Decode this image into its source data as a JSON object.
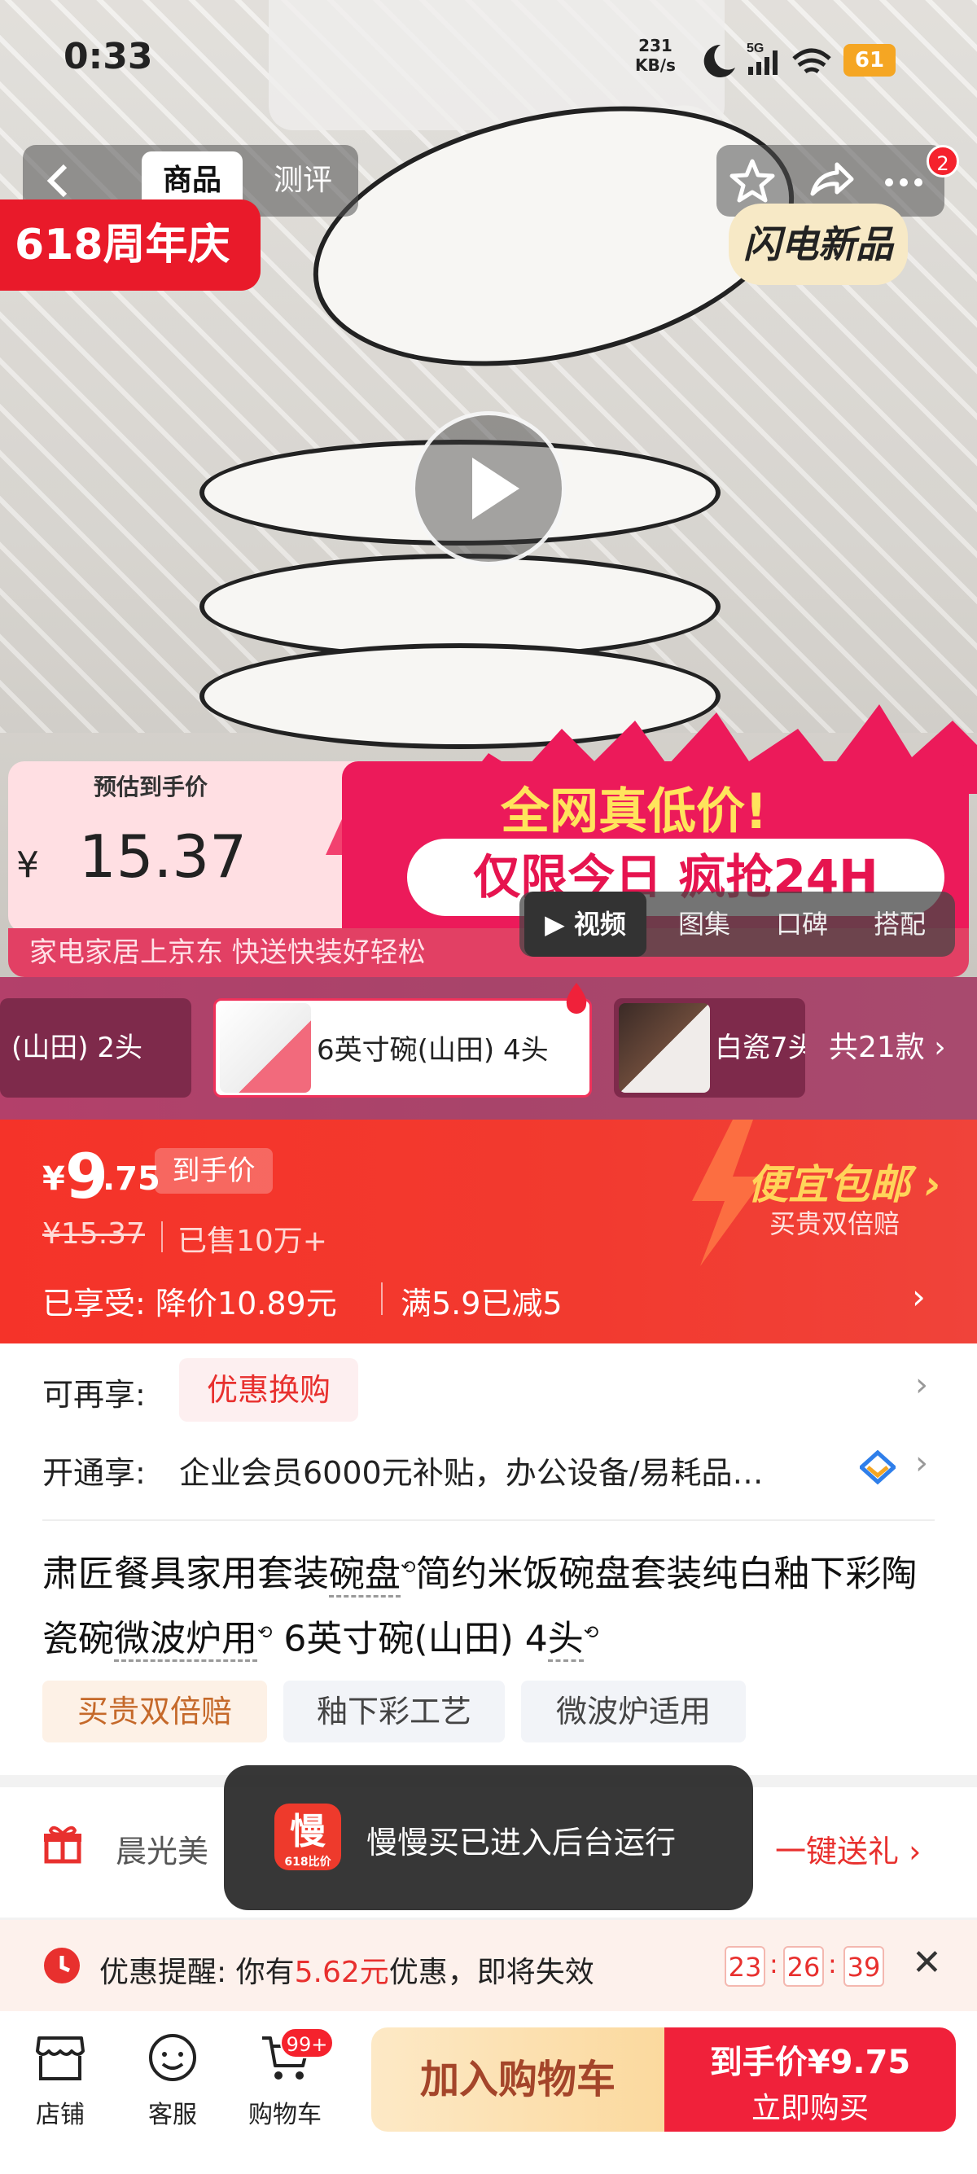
{
  "status_bar": {
    "time": "0:33",
    "net_speed_value": "231",
    "net_speed_unit": "KB/s",
    "network": "5G",
    "battery": "61"
  },
  "header": {
    "tab_product": "商品",
    "tab_review": "测评",
    "cart_badge": "2"
  },
  "hero": {
    "promo_tag": "618周年庆",
    "new_tag": "闪电新品",
    "banner_label": "预估到手价",
    "banner_currency": "¥",
    "banner_price": "15.37",
    "banner_headline": "全网真低价!",
    "banner_sub": "仅限今日 疯抢24H",
    "banner_bottom": "家电家居上京东 快送快装好轻松",
    "media_tabs": [
      "视频",
      "图集",
      "口碑",
      "搭配"
    ]
  },
  "sku": {
    "items": [
      "(山田) 2头",
      "6英寸碗(山田) 4头",
      "白瓷7头"
    ],
    "total": "共21款"
  },
  "price": {
    "currency": "¥",
    "integer": "9",
    "decimal": ".75",
    "tag": "到手价",
    "original": "¥15.37",
    "sold": "已售10万+",
    "enjoyed_label": "已享受:",
    "discount": "降价10.89元",
    "full_reduction": "满5.9已减5",
    "free_ship": "便宜包邮",
    "free_ship_sub": "买贵双倍赔"
  },
  "info": {
    "more_label": "可再享:",
    "coupon_button": "优惠换购",
    "open_label": "开通享:",
    "open_text": "企业会员6000元补贴，办公设备/易耗品…",
    "title_part1": "肃匠餐具家用套装",
    "title_link1": "碗盘",
    "title_part2": "简约米饭碗盘套装纯白釉下彩陶瓷碗",
    "title_link2": "微波炉用",
    "title_part3": " 6英寸碗(山田) 4",
    "title_link3": "头",
    "chips": [
      "买贵双倍赔",
      "釉下彩工艺",
      "微波炉适用"
    ]
  },
  "gift": {
    "text": "晨光美",
    "action": "一键送礼"
  },
  "toast": {
    "icon_char": "慢",
    "icon_sub": "618比价",
    "text": "慢慢买已进入后台运行"
  },
  "reminder": {
    "label": "优惠提醒:",
    "text_before": "你有",
    "amount": "5.62元",
    "text_after": "优惠，即将失效",
    "hours": "23",
    "minutes": "26",
    "seconds": "39"
  },
  "bottom_bar": {
    "store": "店铺",
    "service": "客服",
    "cart": "购物车",
    "cart_badge": "99+",
    "add_to_cart": "加入购物车",
    "buy_price_label": "到手价¥9.75",
    "buy_now": "立即购买"
  },
  "colors": {
    "brand_red": "#f0213a",
    "price_red": "#f53329",
    "accent_gold": "#ffd45a"
  }
}
